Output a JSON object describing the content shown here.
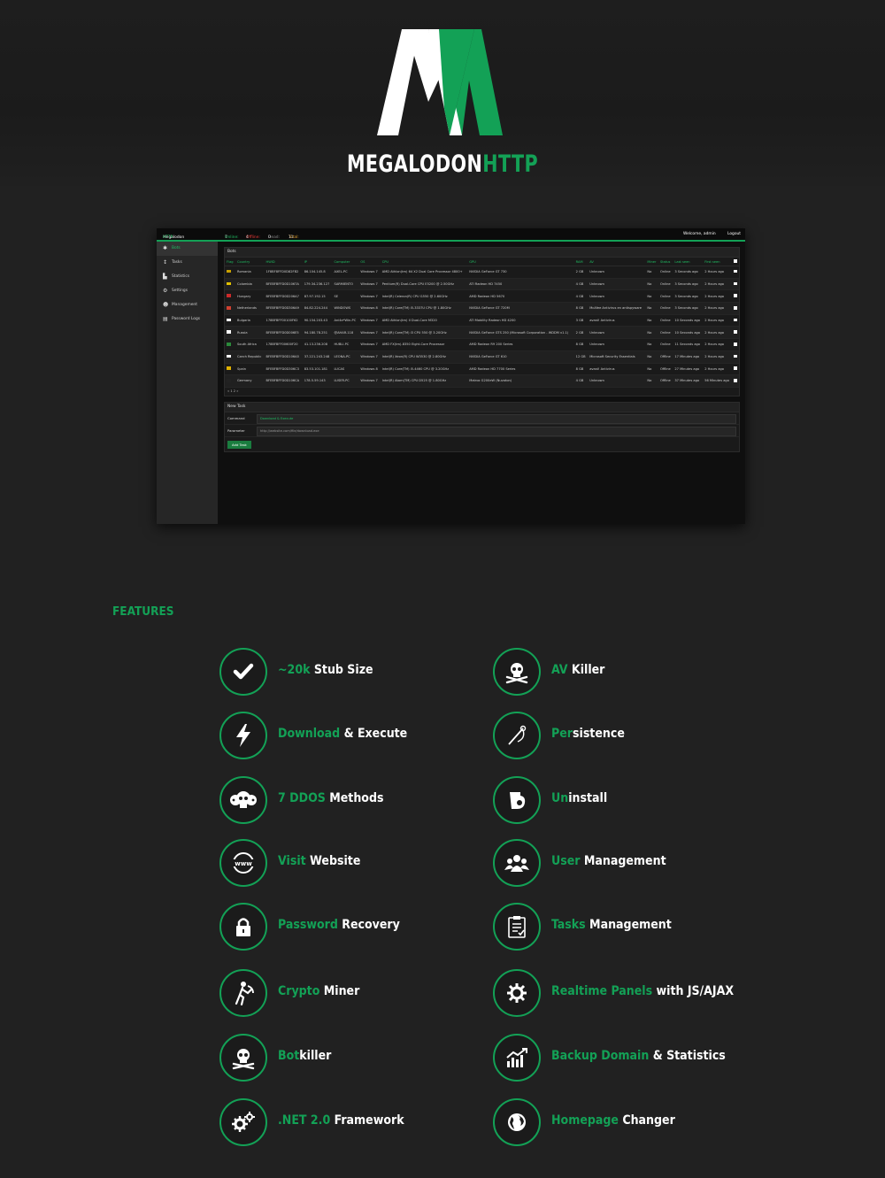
{
  "brand": {
    "part1": "MEGALODON",
    "part2": "HTTP"
  },
  "panel": {
    "app_name_part1": "Megalodon",
    "app_name_part2": "HTTP",
    "stats": {
      "online_label": "Online:",
      "online": "7",
      "offline_label": "Offline:",
      "offline": "4",
      "dead_label": "Dead:",
      "dead": "0",
      "total_label": "Total:",
      "total": "11"
    },
    "welcome": "Welcome, admin",
    "logout": "Logout",
    "sidebar": [
      {
        "label": "Bots",
        "icon": "bots-icon"
      },
      {
        "label": "Tasks",
        "icon": "tasks-icon"
      },
      {
        "label": "Statistics",
        "icon": "statistics-icon"
      },
      {
        "label": "Settings",
        "icon": "settings-icon"
      },
      {
        "label": "Management",
        "icon": "users-icon"
      },
      {
        "label": "Password Logs",
        "icon": "document-icon"
      }
    ],
    "bots_title": "Bots",
    "columns": [
      "Flag",
      "Country",
      "HWID",
      "IP",
      "Computer",
      "OS",
      "CPU",
      "GPU",
      "RAM",
      "AV",
      "Miner",
      "Status",
      "Last seen",
      "First seen"
    ],
    "rows": [
      [
        "Romania",
        "1F8BF8FFD0D82FB2",
        "86.104.145.8",
        "AXEL-PC",
        "Windows 7",
        "AMD Athlon(tm) 64 X2 Dual Core Processor 4800+",
        "NVIDIA GeForce GT 730",
        "2 GB",
        "Unknown",
        "No",
        "Online",
        "3 Seconds ago",
        "2 Hours ago"
      ],
      [
        "Colombia",
        "BFEBFBFFD0D1067A",
        "179.34.236.127",
        "SARMIENTO",
        "Windows 7",
        "Pentium(R) Dual-Core CPU E5200 @ 2.50GHz",
        "ATI Radeon HD 7450",
        "4 GB",
        "Unknown",
        "No",
        "Online",
        "3 Seconds ago",
        "2 Hours ago"
      ],
      [
        "Hungary",
        "BFEBFBFFD0D206A7",
        "87.97.192.15",
        "SE",
        "Windows 7",
        "Intel(R) Celeron(R) CPU G550 @ 2.60GHz",
        "AMD Radeon HD 5670",
        "4 GB",
        "Unknown",
        "No",
        "Online",
        "3 Seconds ago",
        "2 Hours ago"
      ],
      [
        "Netherlands",
        "BFEBFBFFD0D306A9",
        "84.82.224.244",
        "WINDOWS",
        "Windows 8",
        "Intel(R) Core(TM) i5-3337U CPU @ 1.80GHz",
        "NVIDIA GeForce GT 720M",
        "8 GB",
        "McAfee Antivirus en antispyware",
        "No",
        "Online",
        "3 Seconds ago",
        "2 Hours ago"
      ],
      [
        "Bulgaria",
        "178BFBFF00100F62",
        "90.154.203.43",
        "Ani4e*Win-PC",
        "Windows 7",
        "AMD Athlon(tm) II Dual-Core M320",
        "ATI Mobility Radeon HD 4200",
        "3 GB",
        "avast! Antivirus",
        "No",
        "Online",
        "10 Seconds ago",
        "2 Hours ago"
      ],
      [
        "Russia",
        "BFEBFBFFD0D006E5",
        "94.180.78.251",
        "@AHAR-118",
        "Windows 7",
        "Intel(R) Core(TM) i3 CPU 550 @ 3.20GHz",
        "NVIDIA GeForce GTS 250 (Microsoft Corporation - WDDM v1.1)",
        "2 GB",
        "Unknown",
        "No",
        "Online",
        "10 Seconds ago",
        "2 Hours ago"
      ],
      [
        "South Africa",
        "178BFBFF00600F20",
        "41.13.236.208",
        "HUBLI-PC",
        "Windows 7",
        "AMD FX(tm)-8350 Eight-Core Processor",
        "AMD Radeon R9 200 Series",
        "8 GB",
        "Unknown",
        "No",
        "Online",
        "11 Seconds ago",
        "2 Hours ago"
      ],
      [
        "Czech Republic",
        "BFEBFBFFD0D106A5",
        "37.221.243.248",
        "LEONA-PC",
        "Windows 7",
        "Intel(R) Xeon(R) CPU W3530 @ 2.80GHz",
        "NVIDIA GeForce GT 610",
        "12 GB",
        "Microsoft Security Essentials",
        "No",
        "Offline",
        "17 Minutes ago",
        "2 Hours ago"
      ],
      [
        "Spain",
        "BFEBFBFFD0D306C3",
        "83.53.101.181",
        "LUCAS",
        "Windows 8",
        "Intel(R) Core(TM) i5-4460 CPU @ 3.20GHz",
        "AMD Radeon HD 7700 Series",
        "8 GB",
        "avast! Antivirus",
        "No",
        "Offline",
        "27 Minutes ago",
        "2 Hours ago"
      ],
      [
        "Germany",
        "BFEBFBFFD0D106CA",
        "178.5.59.143",
        "LUSER-PC",
        "Windows 7",
        "Intel(R) Atom(TM) CPU D525 @ 1.80GHz",
        "Matrox G200eW (Nuvoton)",
        "4 GB",
        "Unknown",
        "No",
        "Offline",
        "37 Minutes ago",
        "56 Minutes ago"
      ]
    ],
    "pager": "« 1 2 »",
    "new_task_title": "New Task",
    "command_label": "Command",
    "command_value": "Download & Execute",
    "parameter_label": "Parameter",
    "parameter_value": "http://website.com/file/download.exe",
    "add_task": "Add Task"
  },
  "features_title": "FEATURES",
  "features": [
    {
      "icon": "checkmark-icon",
      "hl": "~20k",
      "rest": " Stub Size"
    },
    {
      "icon": "skull-icon",
      "hl": "AV",
      "rest": " Killer"
    },
    {
      "icon": "lightning-icon",
      "hl": "Download",
      "rest": " & Execute"
    },
    {
      "icon": "needle-icon",
      "hl": "Per",
      "rest": "sistence"
    },
    {
      "icon": "skulls-icon",
      "hl": "7 DDOS",
      "rest": " Methods"
    },
    {
      "icon": "trash-icon",
      "hl": "Un",
      "rest": "install"
    },
    {
      "icon": "www-icon",
      "hl": "Visit",
      "rest": " Website"
    },
    {
      "icon": "users-icon",
      "hl": "User",
      "rest": " Management"
    },
    {
      "icon": "lock-icon",
      "hl": "Password",
      "rest": " Recovery"
    },
    {
      "icon": "clipboard-icon",
      "hl": "Tasks",
      "rest": " Management"
    },
    {
      "icon": "miner-icon",
      "hl": "Crypto",
      "rest": " Miner"
    },
    {
      "icon": "gear-icon",
      "hl": "Realtime Panels",
      "rest": " with JS/AJAX"
    },
    {
      "icon": "skull-crossbones-icon",
      "hl": "Bot",
      "rest": "killer"
    },
    {
      "icon": "chart-icon",
      "hl": "Backup Domain",
      "rest": " & Statistics"
    },
    {
      "icon": "gears-icon",
      "hl": ".NET 2.0",
      "rest": " Framework"
    },
    {
      "icon": "globe-icon",
      "hl": "Homepage",
      "rest": " Changer"
    }
  ],
  "colors": {
    "accent": "#13a156",
    "background": "#212121",
    "offline": "#e53935"
  }
}
